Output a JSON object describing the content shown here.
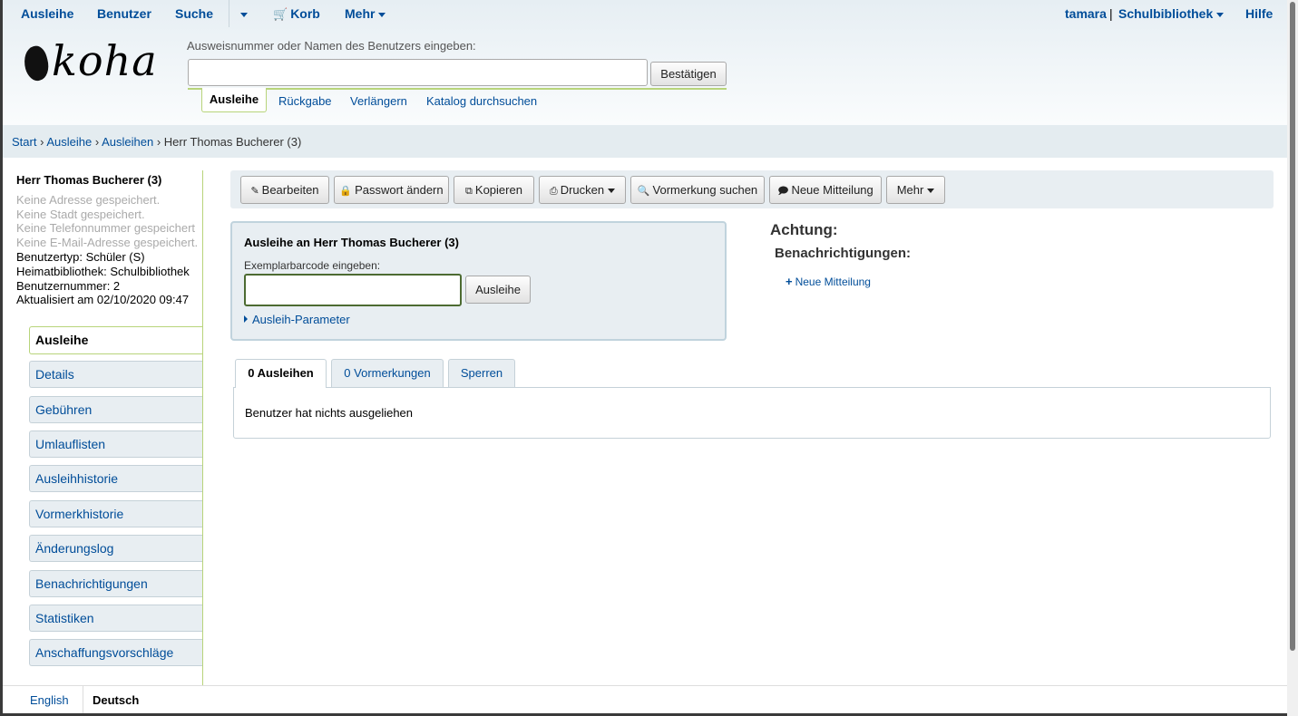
{
  "topnav": {
    "circulation": "Ausleihe",
    "patrons": "Benutzer",
    "search": "Suche",
    "cart": "Korb",
    "more": "Mehr",
    "user": "tamara",
    "separator": "|",
    "library": "Schulbibliothek",
    "help": "Hilfe"
  },
  "logo": "koha",
  "search": {
    "label": "Ausweisnummer oder Namen des Benutzers eingeben:",
    "value": "",
    "submit": "Bestätigen",
    "tabs": [
      "Ausleihe",
      "Rückgabe",
      "Verlängern",
      "Katalog durchsuchen"
    ]
  },
  "breadcrumb": {
    "items": [
      "Start",
      "Ausleihe",
      "Ausleihen"
    ],
    "current": "Herr Thomas Bucherer (3)",
    "sep": "›"
  },
  "patron": {
    "name": "Herr Thomas Bucherer (3)",
    "no_address": "Keine Adresse gespeichert.",
    "no_city": "Keine Stadt gespeichert.",
    "no_phone": "Keine Telefonnummer gespeichert",
    "no_email": "Keine E-Mail-Adresse gespeichert.",
    "category": "Benutzertyp: Schüler (S)",
    "home_library": "Heimatbibliothek: Schulbibliothek",
    "number": "Benutzernummer: 2",
    "updated": "Aktualisiert am 02/10/2020 09:47"
  },
  "sidebar": {
    "items": [
      {
        "label": "Ausleihe"
      },
      {
        "label": "Details"
      },
      {
        "label": "Gebühren"
      },
      {
        "label": "Umlauflisten"
      },
      {
        "label": "Ausleihhistorie"
      },
      {
        "label": "Vormerkhistorie"
      },
      {
        "label": "Änderungslog"
      },
      {
        "label": "Benachrichtigungen"
      },
      {
        "label": "Statistiken"
      },
      {
        "label": "Anschaffungsvorschläge"
      }
    ]
  },
  "toolbar": {
    "edit": "Bearbeiten",
    "password": "Passwort ändern",
    "copy": "Kopieren",
    "print": "Drucken",
    "hold_search": "Vormerkung suchen",
    "new_message": "Neue Mitteilung",
    "more": "Mehr"
  },
  "checkout": {
    "title": "Ausleihe an Herr Thomas Bucherer (3)",
    "barcode_label": "Exemplarbarcode eingeben:",
    "barcode_value": "",
    "button": "Ausleihe",
    "params": "Ausleih-Parameter"
  },
  "attention": {
    "title": "Achtung:",
    "notices_title": "Benachrichtigungen:",
    "new_notice": "Neue Mitteilung"
  },
  "tabs": {
    "checkouts": "0 Ausleihen",
    "holds": "0 Vormerkungen",
    "restrictions": "Sperren",
    "empty_message": "Benutzer hat nichts ausgeliehen"
  },
  "footer": {
    "english": "English",
    "deutsch": "Deutsch"
  }
}
